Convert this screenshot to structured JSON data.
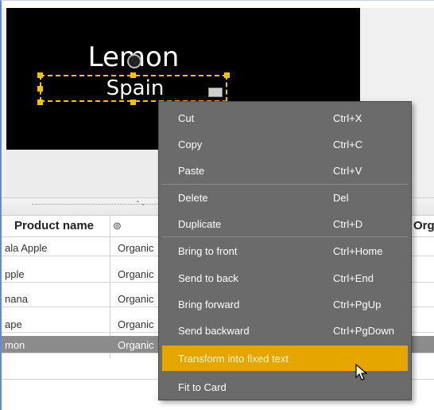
{
  "card": {
    "title": "Lemon",
    "subtitle": "Spain"
  },
  "table": {
    "columns": [
      "Product name",
      "⊚",
      "Org"
    ],
    "rows": [
      {
        "name": "ala Apple",
        "org": "Organic"
      },
      {
        "name": "pple",
        "org": "Organic"
      },
      {
        "name": "nana",
        "org": "Organic"
      },
      {
        "name": "ape",
        "org": "Organic"
      },
      {
        "name": "mon",
        "org": "Organic",
        "selected": true
      }
    ]
  },
  "context_menu": {
    "items": [
      {
        "label": "Cut",
        "shortcut": "Ctrl+X"
      },
      {
        "label": "Copy",
        "shortcut": "Ctrl+C"
      },
      {
        "label": "Paste",
        "shortcut": "Ctrl+V"
      },
      {
        "label": "Delete",
        "shortcut": "Del"
      },
      {
        "label": "Duplicate",
        "shortcut": "Ctrl+D"
      },
      {
        "label": "Bring to front",
        "shortcut": "Ctrl+Home"
      },
      {
        "label": "Send to back",
        "shortcut": "Ctrl+End"
      },
      {
        "label": "Bring forward",
        "shortcut": "Ctrl+PgUp"
      },
      {
        "label": "Send backward",
        "shortcut": "Ctrl+PgDown"
      },
      {
        "label": "Transform into fixed text",
        "shortcut": "",
        "highlighted": true
      },
      {
        "label": "Fit to Card",
        "shortcut": ""
      }
    ]
  },
  "colors": {
    "accent": "#f6c200",
    "menu_bg": "#6b6b6b",
    "highlight": "#e5a600",
    "selected_row": "#8c8c8c"
  },
  "icons": {
    "move": "move-icon",
    "field": "field-icon",
    "column": "column-type-icon",
    "cursor": "mouse-cursor-icon"
  }
}
